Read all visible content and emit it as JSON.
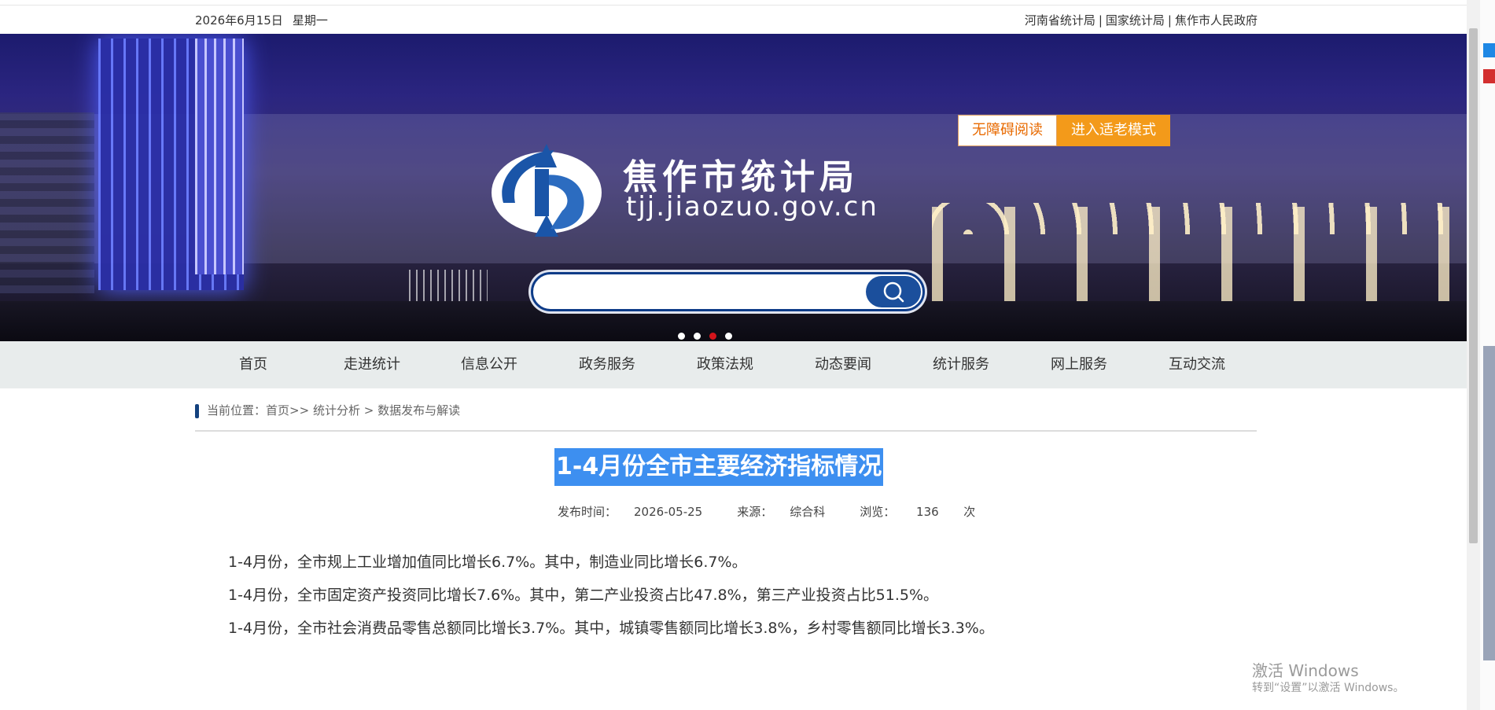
{
  "topbar": {
    "date": "2026年6月15日",
    "weekday": "星期一",
    "links": [
      "河南省统计局",
      "国家统计局",
      "焦作市人民政府"
    ]
  },
  "banner": {
    "site_name": "焦作市统计局",
    "site_url": "tjj.jiaozuo.gov.cn",
    "accessible_label": "无障碍阅读",
    "elder_mode_label": "进入适老模式",
    "search_placeholder": "",
    "carousel_active_index": 2,
    "carousel_count": 4
  },
  "nav": {
    "items": [
      "首页",
      "走进统计",
      "信息公开",
      "政务服务",
      "政策法规",
      "动态要闻",
      "统计服务",
      "网上服务",
      "互动交流"
    ]
  },
  "breadcrumb": {
    "prefix": "当前位置：",
    "home": "首页",
    "sep1": ">>",
    "level1": "统计分析",
    "sep2": ">",
    "level2": "数据发布与解读"
  },
  "article": {
    "title": "1-4月份全市主要经济指标情况",
    "publish_label": "发布时间：",
    "publish_date": "2026-05-25",
    "source_label": "来源：",
    "source": "综合科",
    "views_label": "浏览：",
    "views": "136",
    "views_unit": "次",
    "paragraphs": [
      "1-4月份，全市规上工业增加值同比增长6.7%。其中，制造业同比增长6.7%。",
      "1-4月份，全市固定资产投资同比增长7.6%。其中，第二产业投资占比47.8%，第三产业投资占比51.5%。",
      "1-4月份，全市社会消费品零售总额同比增长3.7%。其中，城镇零售额同比增长3.8%，乡村零售额同比增长3.3%。"
    ]
  },
  "watermark": {
    "line1": "激活 Windows",
    "line2": "转到“设置”以激活 Windows。"
  },
  "colors": {
    "nav_bg": "#e8ecec",
    "title_highlight": "#3d8ff0",
    "elder_button": "#f39a1a",
    "accent_blue": "#14417e"
  }
}
